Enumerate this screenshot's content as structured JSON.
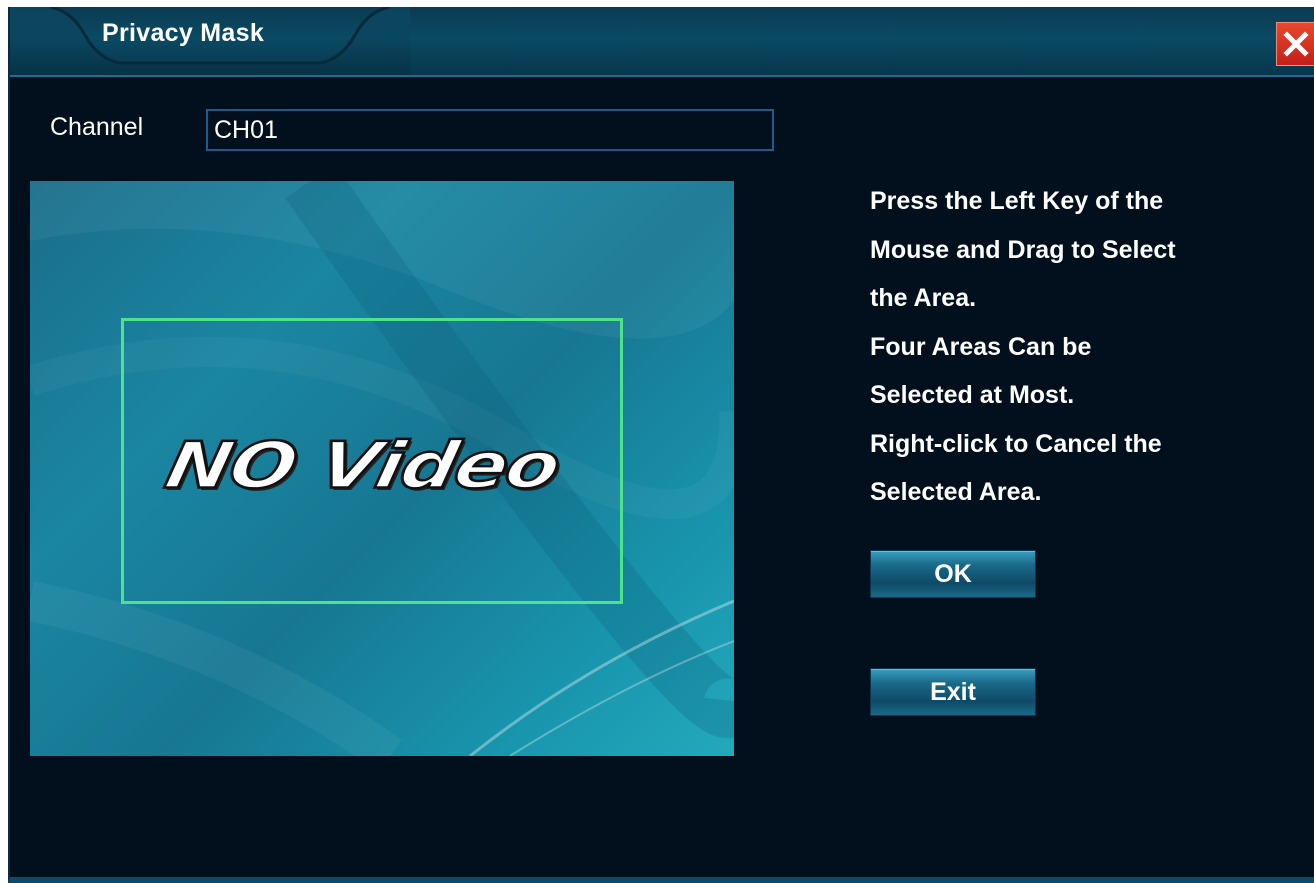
{
  "window": {
    "title": "Privacy Mask"
  },
  "channel": {
    "label": "Channel",
    "value": "CH01"
  },
  "preview": {
    "placeholder_text": "NO Video"
  },
  "help": {
    "lines": [
      "Press the Left Key of the",
      "Mouse and Drag to Select",
      "the Area.",
      "Four Areas Can be",
      "Selected at Most.",
      "Right-click to Cancel the",
      "Selected Area."
    ]
  },
  "buttons": {
    "ok_label": "OK",
    "exit_label": "Exit"
  },
  "colors": {
    "background": "#020f1d",
    "title_bar": "#0a4a64",
    "mask_border": "#4ee38a",
    "close_button": "#d4301e"
  },
  "icons": {
    "close": "close-icon"
  }
}
